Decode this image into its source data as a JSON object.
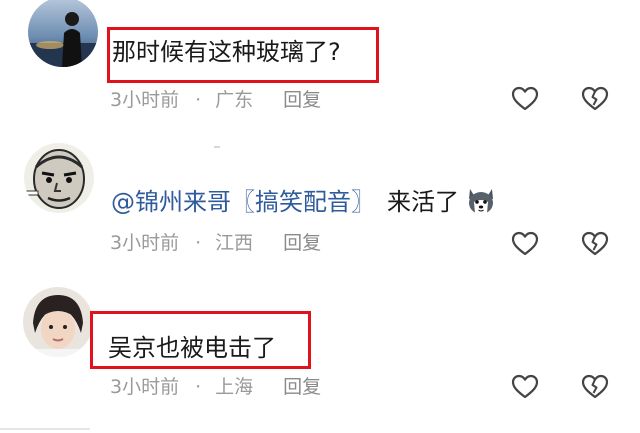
{
  "comments": [
    {
      "text": "那时候有这种玻璃了?",
      "time": "3小时前",
      "dot": "·",
      "location": "广东",
      "reply": "回复"
    },
    {
      "mention": "@锦州来哥〖搞笑配音〗",
      "text": "来活了",
      "emoji": "husky-dog-emoji",
      "time": "3小时前",
      "dot": "·",
      "location": "江西",
      "reply": "回复"
    },
    {
      "text": "吴京也被电击了",
      "time": "3小时前",
      "dot": "·",
      "location": "上海",
      "reply": "回复"
    }
  ],
  "icons": {
    "like": "heart-outline-icon",
    "dislike": "broken-heart-icon"
  },
  "colors": {
    "highlight_box": "#e0131c",
    "mention": "#2f5b9c",
    "meta_text": "#9a9a9a"
  }
}
